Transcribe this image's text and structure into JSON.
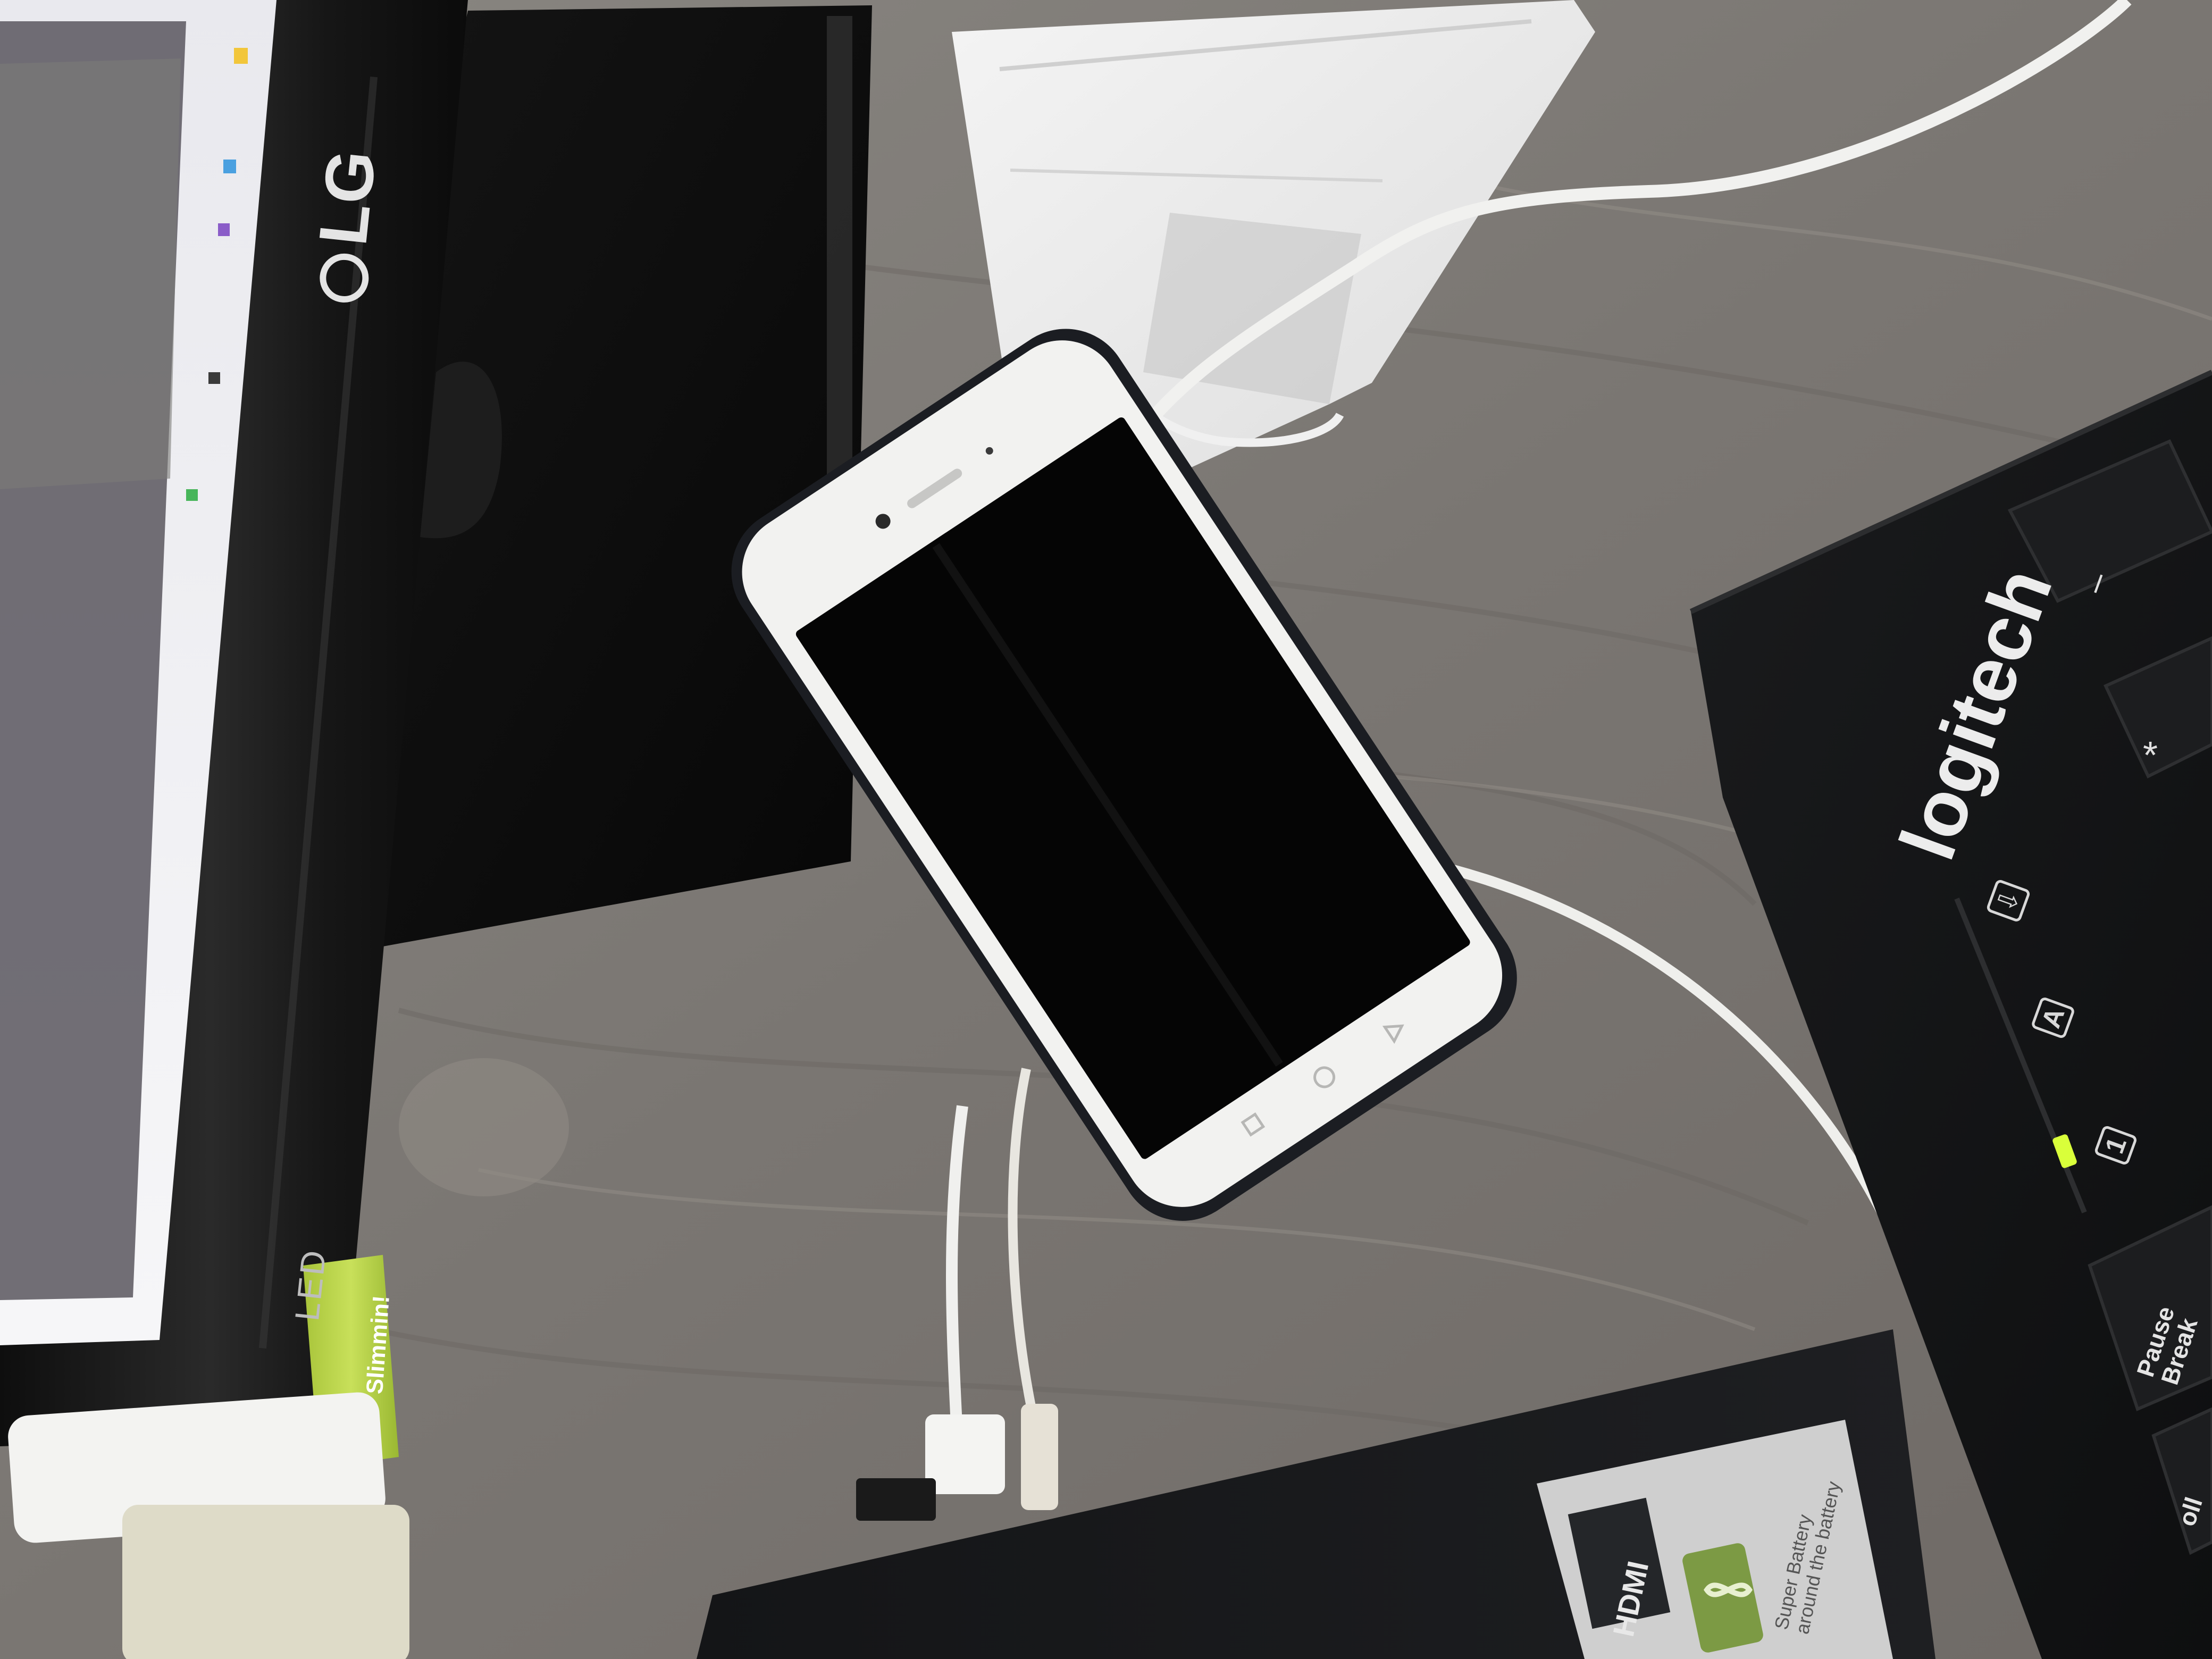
{
  "monitor": {
    "brand": "LG",
    "panel_badge": "LED",
    "bezel_color": "#121212",
    "screen_color": "#e6e6ea"
  },
  "phone": {
    "body_color": "#f2f2f0",
    "screen_color": "#050505",
    "nav_icons": [
      "back-triangle-icon",
      "home-circle-icon",
      "recents-square-icon"
    ]
  },
  "keyboard": {
    "brand": "logitech",
    "key_minus": "–",
    "key_asterisk": "*",
    "indicator_num": "1",
    "indicator_caps": "A",
    "indicator_scroll": "⇩",
    "pause_key_line1": "Pause",
    "pause_key_line2": "Break",
    "scroll_key_partial": "oll",
    "led_color": "#d9ff3a"
  },
  "tube": {
    "label": "Slimmin!"
  },
  "device_box": {
    "hdmi_label": "HDMI",
    "battery_line1": "Super Battery",
    "battery_line2": "around the battery"
  }
}
